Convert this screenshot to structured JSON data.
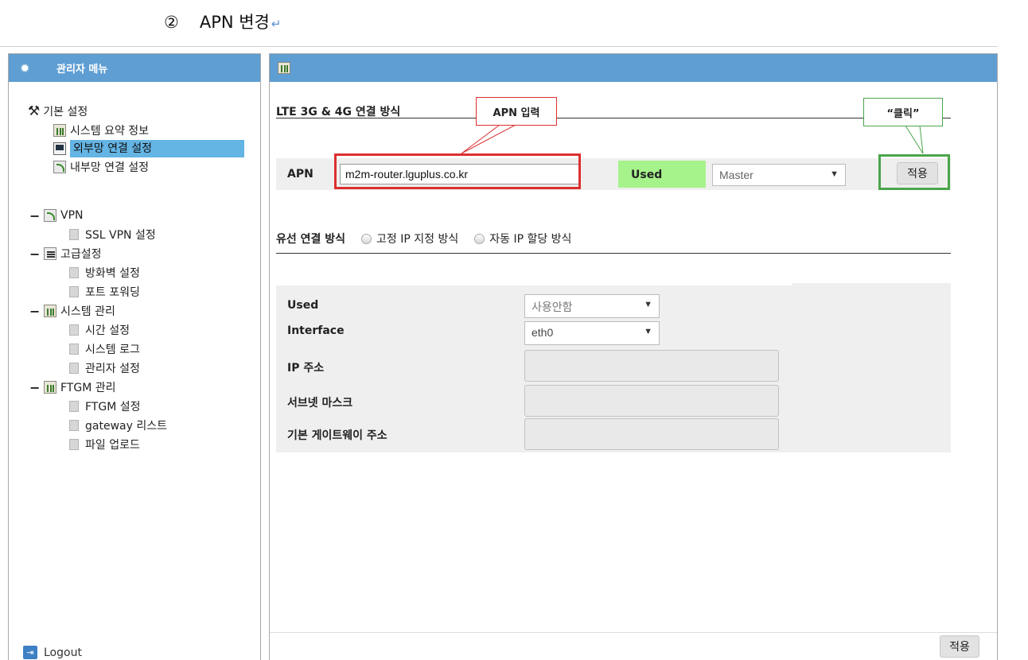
{
  "doc_heading": {
    "number": "②",
    "text": "APN 변경",
    "return_mark": "↵"
  },
  "sidebar": {
    "header": "관리자 메뉴",
    "groups": [
      {
        "label": "기본 설정",
        "items": [
          "시스템 요약 정보",
          "외부망 연결 설정",
          "내부망 연결 설정"
        ]
      },
      {
        "label": "VPN",
        "items": [
          "SSL VPN 설정"
        ]
      },
      {
        "label": "고급설정",
        "items": [
          "방화벽 설정",
          "포트 포워딩"
        ]
      },
      {
        "label": "시스템 관리",
        "items": [
          "시간 설정",
          "시스템 로그",
          "관리자 설정"
        ]
      },
      {
        "label": "FTGM 관리",
        "items": [
          "FTGM 설정",
          "gateway 리스트",
          "파일 업로드"
        ]
      }
    ],
    "selected_item": "외부망 연결 설정",
    "logout": "Logout"
  },
  "main": {
    "lte": {
      "title": "LTE 3G & 4G 연결 방식",
      "apn_label": "APN",
      "apn_value": "m2m-router.lguplus.co.kr",
      "used_label": "Used",
      "mode_value": "Master",
      "apply_button": "적용"
    },
    "annotations": {
      "apn_callout": "APN 입력",
      "click_callout": "“클릭”"
    },
    "wired": {
      "title": "유선 연결 방식",
      "options": [
        "고정 IP 지정 방식",
        "자동 IP 할당 방식"
      ]
    },
    "form": {
      "used_label": "Used",
      "used_value": "사용안함",
      "interface_label": "Interface",
      "interface_value": "eth0",
      "ip_label": "IP 주소",
      "subnet_label": "서브넷 마스크",
      "gateway_label": "기본 게이트웨이 주소"
    },
    "footer_apply": "적용"
  },
  "colors": {
    "header_blue": "#5f9ed3",
    "selected_blue": "#64b4e4",
    "used_green": "#a6f28b",
    "annot_red": "#dc2f2f",
    "annot_green": "#4aa54a"
  }
}
